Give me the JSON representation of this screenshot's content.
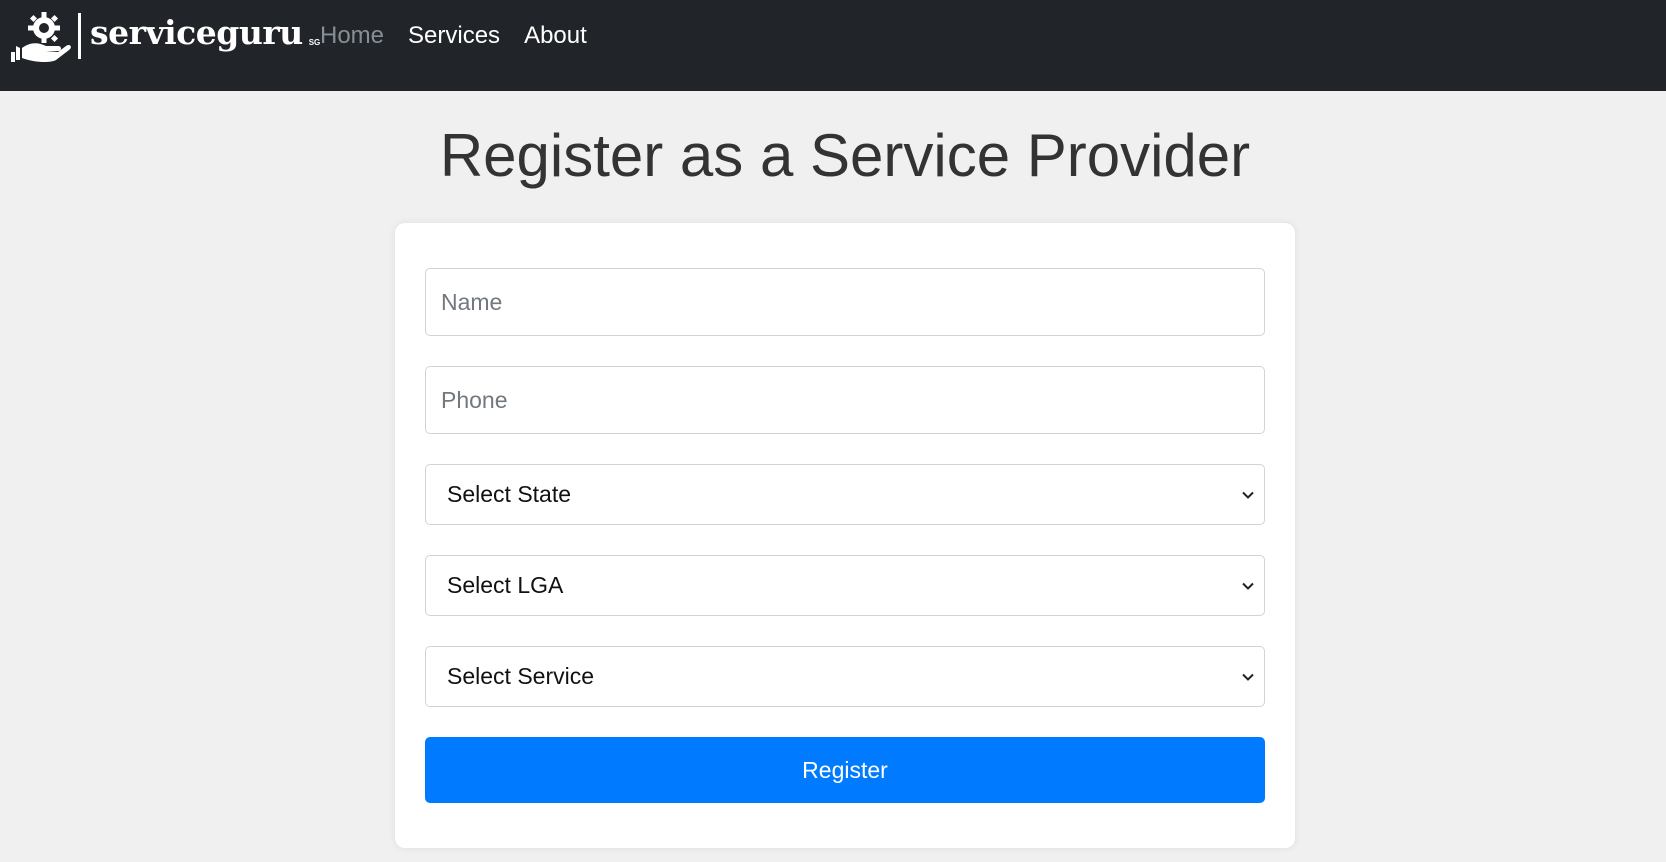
{
  "header": {
    "brand_name": "serviceguru",
    "brand_sub": "SG",
    "nav": [
      {
        "label": "Home"
      },
      {
        "label": "Services"
      },
      {
        "label": "About"
      }
    ]
  },
  "page": {
    "title": "Register as a Service Provider"
  },
  "form": {
    "name_placeholder": "Name",
    "phone_placeholder": "Phone",
    "state_select": "Select State",
    "lga_select": "Select LGA",
    "service_select": "Select Service",
    "submit_label": "Register"
  },
  "colors": {
    "navbar": "#212529",
    "background": "#f0f0f0",
    "primary_button": "#007bff"
  },
  "icons": {
    "brand_logo": "hand-gear-logo",
    "select_arrow": "chevron-down-icon"
  }
}
